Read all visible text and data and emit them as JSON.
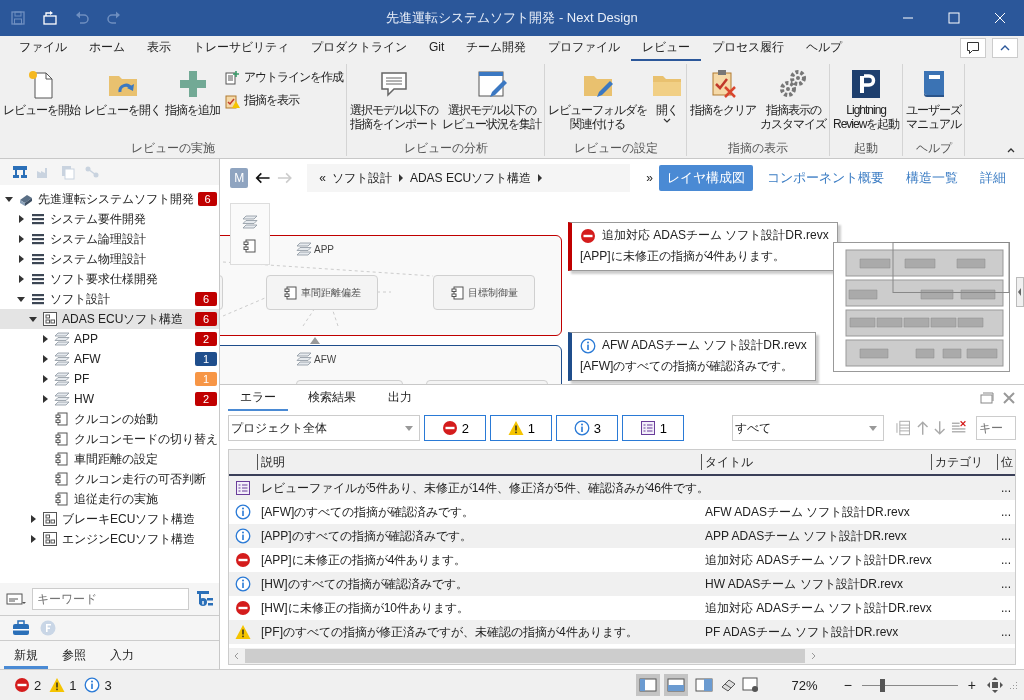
{
  "window": {
    "title": "先進運転システムソフト開発 - Next Design"
  },
  "quick_access": [
    {
      "disabled": true
    },
    {
      "disabled": false
    },
    {
      "disabled": true
    },
    {
      "disabled": true
    }
  ],
  "menu_tabs": [
    {
      "label": "ファイル",
      "selected": false
    },
    {
      "label": "ホーム",
      "selected": false
    },
    {
      "label": "表示",
      "selected": false
    },
    {
      "label": "トレーサビリティ",
      "selected": false
    },
    {
      "label": "プロダクトライン",
      "selected": false
    },
    {
      "label": "Git",
      "selected": false
    },
    {
      "label": "チーム開発",
      "selected": false
    },
    {
      "label": "プロファイル",
      "selected": false
    },
    {
      "label": "レビュー",
      "selected": true
    },
    {
      "label": "プロセス履行",
      "selected": false
    },
    {
      "label": "ヘルプ",
      "selected": false
    }
  ],
  "ribbon": {
    "groups": [
      {
        "label": "レビューの実施",
        "buttons": [
          {
            "label": "レビューを開始",
            "kind": "large"
          },
          {
            "label": "レビューを開く",
            "kind": "large"
          },
          {
            "label": "指摘を追加",
            "kind": "large"
          },
          {
            "label": "アウトラインを作成",
            "kind": "small"
          },
          {
            "label": "指摘を表示",
            "kind": "small"
          }
        ]
      },
      {
        "label": "レビューの分析",
        "buttons": [
          {
            "lines": [
              "選択モデル以下の",
              "指摘をインポート"
            ],
            "kind": "large"
          },
          {
            "lines": [
              "選択モデル以下の",
              "レビュー状況を集計"
            ],
            "kind": "large"
          }
        ]
      },
      {
        "label": "レビューの設定",
        "buttons": [
          {
            "lines": [
              "レビューフォルダを",
              "関連付ける"
            ],
            "kind": "large"
          },
          {
            "label": "開く",
            "kind": "dropdown"
          }
        ]
      },
      {
        "label": "指摘の表示",
        "buttons": [
          {
            "label": "指摘をクリア",
            "kind": "large"
          },
          {
            "lines": [
              "指摘表示の",
              "カスタマイズ"
            ],
            "kind": "large"
          }
        ]
      },
      {
        "label": "起動",
        "buttons": [
          {
            "lines": [
              "Lightning",
              "Reviewを起動"
            ],
            "kind": "large"
          }
        ]
      },
      {
        "label": "ヘルプ",
        "buttons": [
          {
            "lines": [
              "ユーザーズ",
              "マニュアル"
            ],
            "kind": "large"
          }
        ]
      }
    ]
  },
  "tree_toolbar": [
    {
      "disabled": false
    },
    {
      "disabled": true
    },
    {
      "disabled": true
    },
    {
      "disabled": true
    }
  ],
  "tree": [
    {
      "label": "先進運転システムソフト開発",
      "kind": "project",
      "expanded": true,
      "selected": false,
      "badge": {
        "text": "6",
        "color": "#c00000"
      },
      "children": [
        {
          "label": "システム要件開発",
          "kind": "list",
          "expanded": false,
          "selected": false
        },
        {
          "label": "システム論理設計",
          "kind": "list",
          "expanded": false,
          "selected": false
        },
        {
          "label": "システム物理設計",
          "kind": "list",
          "expanded": false,
          "selected": false
        },
        {
          "label": "ソフト要求仕様開発",
          "kind": "list",
          "expanded": false,
          "selected": false
        },
        {
          "label": "ソフト設計",
          "kind": "list",
          "expanded": true,
          "selected": false,
          "badge": {
            "text": "6",
            "color": "#c00000"
          },
          "children": [
            {
              "label": "ADAS ECUソフト構造",
              "kind": "structure",
              "expanded": true,
              "selected": true,
              "badge": {
                "text": "6",
                "color": "#c00000"
              },
              "children": [
                {
                  "label": "APP",
                  "kind": "layer",
                  "expanded": false,
                  "selected": false,
                  "badge": {
                    "text": "2",
                    "color": "#c00000"
                  }
                },
                {
                  "label": "AFW",
                  "kind": "layer",
                  "expanded": false,
                  "selected": false,
                  "badge": {
                    "text": "1",
                    "color": "#1f4e8c"
                  }
                },
                {
                  "label": "PF",
                  "kind": "layer",
                  "expanded": false,
                  "selected": false,
                  "badge": {
                    "text": "1",
                    "color": "#f79646"
                  }
                },
                {
                  "label": "HW",
                  "kind": "layer",
                  "expanded": false,
                  "selected": false,
                  "badge": {
                    "text": "2",
                    "color": "#c00000"
                  }
                },
                {
                  "label": "クルコンの始動",
                  "kind": "component",
                  "selected": false
                },
                {
                  "label": "クルコンモードの切り替え",
                  "kind": "component",
                  "selected": false
                },
                {
                  "label": "車間距離の設定",
                  "kind": "component",
                  "selected": false
                },
                {
                  "label": "クルコン走行の可否判断",
                  "kind": "component",
                  "selected": false
                },
                {
                  "label": "追従走行の実施",
                  "kind": "component",
                  "selected": false
                }
              ]
            },
            {
              "label": "ブレーキECUソフト構造",
              "kind": "structure",
              "expanded": false,
              "selected": false
            },
            {
              "label": "エンジンECUソフト構造",
              "kind": "structure",
              "expanded": false,
              "selected": false
            }
          ]
        }
      ]
    }
  ],
  "keyword_search": {
    "placeholder": "キーワード"
  },
  "left_tabs": [
    {
      "label": "新規",
      "selected": true
    },
    {
      "label": "参照",
      "selected": false
    },
    {
      "label": "入力",
      "selected": false
    }
  ],
  "breadcrumb": {
    "avatar": "M",
    "nav": [
      {
        "disabled": false
      },
      {
        "disabled": true
      }
    ],
    "start": "«",
    "items": [
      "ソフト設計",
      "ADAS ECUソフト構造"
    ],
    "overflow": "»"
  },
  "view_tabs": [
    {
      "label": "レイヤ構成図",
      "selected": true
    },
    {
      "label": "コンポーネント概要",
      "selected": false
    },
    {
      "label": "構造一覧",
      "selected": false
    },
    {
      "label": "詳細",
      "selected": false
    }
  ],
  "diagram": {
    "layers": [
      {
        "label": "APP",
        "color": "#c00000",
        "components": [
          {
            "label": "車間距離偏差"
          },
          {
            "label": "目標制御量"
          }
        ]
      },
      {
        "label": "AFW",
        "color": "#1f4e8c"
      }
    ],
    "callouts": [
      {
        "kind": "error",
        "title": "追加対応 ADASチーム ソフト設計DR.revx",
        "message": "[APP]に未修正の指摘が4件あります。"
      },
      {
        "kind": "info",
        "title": "AFW ADASチーム ソフト設計DR.revx",
        "message": "[AFW]のすべての指摘が確認済みです。"
      }
    ]
  },
  "output_panel": {
    "tabs": [
      {
        "label": "エラー",
        "selected": true
      },
      {
        "label": "検索結果",
        "selected": false
      },
      {
        "label": "出力",
        "selected": false
      }
    ],
    "scope": "プロジェクト全体",
    "filters": [
      {
        "kind": "error",
        "count": "2"
      },
      {
        "kind": "warning",
        "count": "1"
      },
      {
        "kind": "info",
        "count": "3"
      },
      {
        "kind": "summary",
        "count": "1"
      }
    ],
    "category": "すべて",
    "search": {
      "placeholder": "キー"
    },
    "columns": [
      "説明",
      "タイトル",
      "カテゴリ",
      "位"
    ],
    "rows": [
      {
        "kind": "summary",
        "description": "レビューファイルが5件あり、未修正が14件、修正済が5件、確認済みが46件です。",
        "column_5": "..."
      },
      {
        "kind": "info",
        "description": "[AFW]のすべての指摘が確認済みです。",
        "title": "AFW ADASチーム ソフト設計DR.revx",
        "column_5": "..."
      },
      {
        "kind": "info",
        "description": "[APP]のすべての指摘が確認済みです。",
        "title": "APP ADASチーム ソフト設計DR.revx",
        "column_5": "..."
      },
      {
        "kind": "error",
        "description": "[APP]に未修正の指摘が4件あります。",
        "title": "追加対応 ADASチーム ソフト設計DR.revx",
        "column_5": "..."
      },
      {
        "kind": "info",
        "description": "[HW]のすべての指摘が確認済みです。",
        "title": "HW ADASチーム ソフト設計DR.revx",
        "column_5": "..."
      },
      {
        "kind": "error",
        "description": "[HW]に未修正の指摘が10件あります。",
        "title": "追加対応 ADASチーム ソフト設計DR.revx",
        "column_5": "..."
      },
      {
        "kind": "warning",
        "description": "[PF]のすべての指摘が修正済みですが、未確認の指摘が4件あります。",
        "title": "PF ADASチーム ソフト設計DR.revx",
        "column_5": "..."
      }
    ]
  },
  "status_bar": {
    "counts": [
      {
        "kind": "error",
        "count": "2"
      },
      {
        "kind": "warning",
        "count": "1"
      },
      {
        "kind": "info",
        "count": "3"
      }
    ],
    "layout_toggles": [
      {
        "selected": true
      },
      {
        "selected": true
      },
      {
        "selected": false
      }
    ],
    "zoom": "72%",
    "zoom_out": "−",
    "zoom_in": "+",
    "zoom_slider": {
      "level": 0.19
    }
  }
}
